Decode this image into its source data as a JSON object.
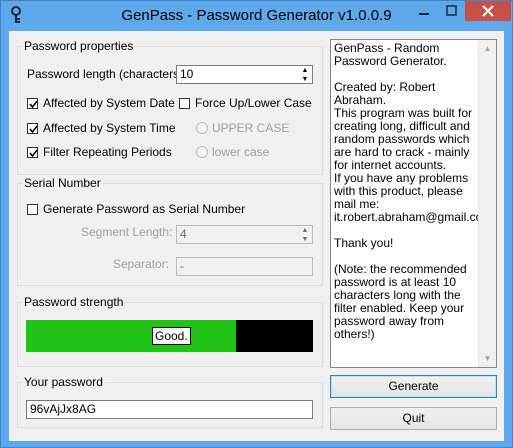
{
  "window": {
    "title": "GenPass - Password Generator v1.0.0.9"
  },
  "properties": {
    "group_title": "Password properties",
    "length_label": "Password length (characters):",
    "length_value": "10",
    "affected_date": {
      "label": "Affected by System Date",
      "checked": true
    },
    "affected_time": {
      "label": "Affected by System Time",
      "checked": true
    },
    "filter_repeating": {
      "label": "Filter Repeating Periods",
      "checked": true
    },
    "force_case": {
      "label": "Force Up/Lower Case",
      "checked": false
    },
    "upper_case": {
      "label": "UPPER CASE",
      "enabled": false
    },
    "lower_case": {
      "label": "lower case",
      "enabled": false
    }
  },
  "serial": {
    "group_title": "Serial Number",
    "generate_serial": {
      "label": "Generate Password as Serial Number",
      "checked": false
    },
    "segment_length_label": "Segment Length:",
    "segment_length_value": "4",
    "separator_label": "Separator:",
    "separator_value": "-"
  },
  "strength": {
    "group_title": "Password strength",
    "label": "Good.",
    "level": 0.73,
    "fill_color": "#1ec515",
    "empty_color": "#000000"
  },
  "output": {
    "group_title": "Your password",
    "password": "96vAjJx8AG"
  },
  "info_text": "GenPass - Random Password Generator.\n\nCreated by: Robert Abraham.\nThis program was built for creating long, difficult and random passwords which are hard to crack - mainly for internet accounts.\nIf you have any problems with this product, please mail me:\nit.robert.abraham@gmail.com\n\nThank you!\n\n(Note: the recommended password is at least 10 characters long with the filter enabled. Keep your password away from others!)",
  "buttons": {
    "generate": "Generate",
    "quit": "Quit"
  },
  "icons": {
    "app": "key-icon",
    "minimize": "minimize-icon",
    "maximize": "maximize-icon",
    "close": "close-icon"
  },
  "colors": {
    "title_bar": "#5fa8ea",
    "close_button": "#c7504b",
    "strength_fill": "#1ec515"
  }
}
